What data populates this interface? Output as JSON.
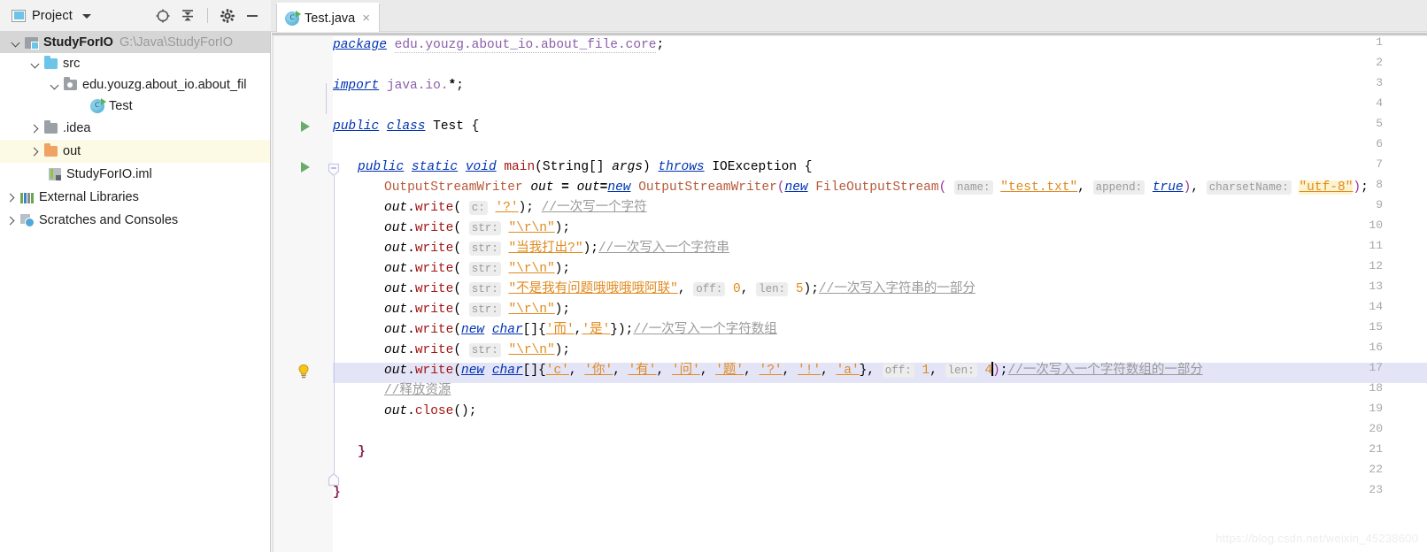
{
  "window": {
    "project_panel_title": "Project",
    "watermark": "https://blog.csdn.net/weixin_45238600"
  },
  "toolbar": {
    "locate_icon": "crosshair-locate-icon",
    "collapse_icon": "collapse-all-icon",
    "settings_icon": "gear-icon",
    "hide_icon": "minimize-icon",
    "dropdown_icon": "chevron-down-icon"
  },
  "tabs": [
    {
      "label": "Test.java",
      "icon": "java-class-icon",
      "close": "×",
      "active": true
    }
  ],
  "sidebar": {
    "items": [
      {
        "indent": 0,
        "arrow": "down",
        "icon": "module-icon",
        "label": "StudyForIO",
        "sub": "G:\\Java\\StudyForIO",
        "bold": true,
        "state": "selected"
      },
      {
        "indent": 1,
        "arrow": "down",
        "icon": "folder-blue",
        "label": "src",
        "sub": "",
        "bold": false,
        "state": "normal"
      },
      {
        "indent": 2,
        "arrow": "down",
        "icon": "package-icon",
        "label": "edu.youzg.about_io.about_fil",
        "sub": "",
        "bold": false,
        "state": "normal"
      },
      {
        "indent": 3,
        "arrow": "none",
        "icon": "java-class-icon",
        "label": "Test",
        "sub": "",
        "bold": false,
        "state": "normal"
      },
      {
        "indent": 1,
        "arrow": "right",
        "icon": "folder-gray",
        "label": ".idea",
        "sub": "",
        "bold": false,
        "state": "normal"
      },
      {
        "indent": 1,
        "arrow": "right",
        "icon": "folder-orange",
        "label": "out",
        "sub": "",
        "bold": false,
        "state": "highlighted"
      },
      {
        "indent": 2,
        "arrow": "none",
        "icon": "iml-file-icon",
        "label": "StudyForIO.iml",
        "sub": "",
        "bold": false,
        "state": "normal"
      },
      {
        "indent": 0,
        "arrow": "right",
        "icon": "libraries-icon",
        "label": "External Libraries",
        "sub": "",
        "bold": false,
        "state": "normal"
      },
      {
        "indent": 0,
        "arrow": "right",
        "icon": "scratches-icon",
        "label": "Scratches and Consoles",
        "sub": "",
        "bold": false,
        "state": "normal"
      }
    ]
  },
  "editor": {
    "file": "Test.java",
    "caret_line": 17,
    "highlighted_line": 17,
    "gutter": {
      "run_markers": [
        5,
        7
      ],
      "bulb_line": 17,
      "fold_open_line": 7,
      "fold_close_line": 21
    },
    "line_numbers": [
      1,
      2,
      3,
      4,
      5,
      6,
      7,
      8,
      9,
      10,
      11,
      12,
      13,
      14,
      15,
      16,
      17,
      18,
      19,
      20,
      21,
      22,
      23
    ],
    "lines": [
      {
        "n": 1,
        "text": "package edu.youzg.about_io.about_file.core;"
      },
      {
        "n": 2,
        "text": ""
      },
      {
        "n": 3,
        "text": "import java.io.*;"
      },
      {
        "n": 4,
        "text": ""
      },
      {
        "n": 5,
        "text": "public class Test {"
      },
      {
        "n": 6,
        "text": ""
      },
      {
        "n": 7,
        "text": "    public static void main(String[] args) throws IOException {"
      },
      {
        "n": 8,
        "text": "        OutputStreamWriter out = out=new OutputStreamWriter(new FileOutputStream( name: \"test.txt\", append: true), charsetName: \"utf-8\");"
      },
      {
        "n": 9,
        "text": "        out.write( c: '?'); //一次写一个字符"
      },
      {
        "n": 10,
        "text": "        out.write( str: \"\\r\\n\");"
      },
      {
        "n": 11,
        "text": "        out.write( str: \"当我打出?\");//一次写入一个字符串"
      },
      {
        "n": 12,
        "text": "        out.write( str: \"\\r\\n\");"
      },
      {
        "n": 13,
        "text": "        out.write( str: \"不是我有问题哦哦哦哦阿联\", off: 0, len: 5);//一次写入字符串的一部分"
      },
      {
        "n": 14,
        "text": "        out.write( str: \"\\r\\n\");"
      },
      {
        "n": 15,
        "text": "        out.write(new char[]{'而','是'});//一次写入一个字符数组"
      },
      {
        "n": 16,
        "text": "        out.write( str: \"\\r\\n\");"
      },
      {
        "n": 17,
        "text": "        out.write(new char[]{'c','你','有','问','题','?','!','a'}, off: 1, len: 4);//一次写入一个字符数组的一部分"
      },
      {
        "n": 18,
        "text": "        //释放资源"
      },
      {
        "n": 19,
        "text": "        out.close();"
      },
      {
        "n": 20,
        "text": ""
      },
      {
        "n": 21,
        "text": "    }"
      },
      {
        "n": 22,
        "text": ""
      },
      {
        "n": 23,
        "text": "}"
      }
    ],
    "inlay_hints": [
      "c:",
      "str:",
      "name:",
      "append:",
      "charsetName:",
      "off:",
      "len:"
    ],
    "literals": {
      "file_name": "\"test.txt\"",
      "append": "true",
      "charset": "\"utf-8\"",
      "char_q": "'?'",
      "crlf": "\"\\r\\n\"",
      "cn_str1": "\"当我打出?\"",
      "cn_str2": "\"不是我有问题哦哦哦哦阿联\"",
      "off0": "0",
      "len5": "5",
      "chars_a": "{'而','是'}",
      "chars_b": "{'c','你','有','问','题','?','!','a'}",
      "off1": "1",
      "len4": "4"
    },
    "comments": {
      "c9": "//一次写一个字符",
      "c11": "//一次写入一个字符串",
      "c13": "//一次写入字符串的一部分",
      "c15": "//一次写入一个字符数组",
      "c17": "//一次写入一个字符数组的一部分",
      "c18": "//释放资源"
    }
  },
  "colors": {
    "keyword": "#0033b3",
    "string": "#e08a1e",
    "comment": "#9a9a9a",
    "type": "#b8593a",
    "method": "#a31515",
    "selection": "#e4e4f7",
    "tree_selection": "#d6d6d6",
    "tree_highlight": "#fcf9e4",
    "folder_blue": "#6cc5e8",
    "folder_orange": "#f0a263",
    "run_green": "#6aab6a"
  }
}
